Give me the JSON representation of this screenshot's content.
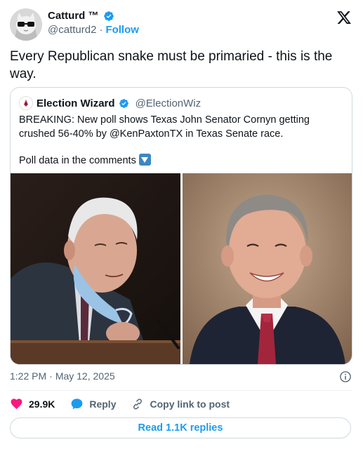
{
  "author": {
    "display_name": "Catturd ™",
    "handle": "@catturd2",
    "separator": "·",
    "follow_label": "Follow"
  },
  "tweet": {
    "text": "Every Republican snake must be primaried - this is the way."
  },
  "quoted": {
    "display_name": "Election Wizard",
    "handle": "@ElectionWiz",
    "line1": "BREAKING: New poll shows Texas John Senator Cornyn getting crushed 56-40% by @KenPaxtonTX in Texas Senate race.",
    "line2": "Poll data in the comments"
  },
  "meta": {
    "time": "1:22 PM",
    "separator": "·",
    "date": "May 12, 2025"
  },
  "actions": {
    "likes": "29.9K",
    "reply_label": "Reply",
    "copy_label": "Copy link to post"
  },
  "replies_button": "Read 1.1K replies",
  "colors": {
    "brand_blue": "#1d9bf0",
    "like_pink": "#f91880",
    "verified_blue": "#1d9bf0"
  },
  "icons": [
    "verified-badge-icon",
    "x-logo-icon",
    "info-icon",
    "heart-icon",
    "reply-bubble-icon",
    "link-icon",
    "down-arrow-emoji"
  ]
}
